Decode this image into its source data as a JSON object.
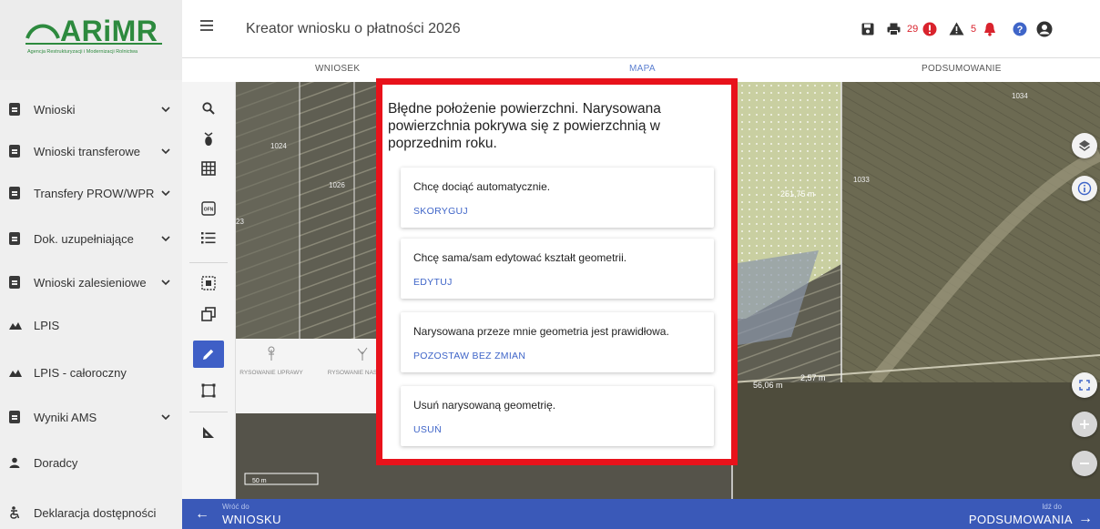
{
  "logo": {
    "name": "ARiMR",
    "subtitle": "Agencja Restrukturyzacji i Modernizacji Rolnictwa"
  },
  "sidebar": {
    "items": [
      {
        "label": "Wnioski",
        "icon": "clipboard-icon",
        "chevron": true
      },
      {
        "label": "Wnioski transferowe",
        "icon": "clipboard-icon",
        "chevron": true
      },
      {
        "label": "Transfery PROW/WPR",
        "icon": "clipboard-icon",
        "chevron": true
      },
      {
        "label": "Dok. uzupełniające",
        "icon": "clipboard-icon",
        "chevron": true
      },
      {
        "label": "Wnioski zalesieniowe",
        "icon": "clipboard-icon",
        "chevron": true
      },
      {
        "label": "LPIS",
        "icon": "mountain-icon",
        "chevron": false
      },
      {
        "label": "LPIS - całoroczny",
        "icon": "mountain-icon",
        "chevron": false
      },
      {
        "label": "Wyniki AMS",
        "icon": "clipboard-icon",
        "chevron": true
      },
      {
        "label": "Doradcy",
        "icon": "person-icon",
        "chevron": false
      },
      {
        "label": "Deklaracja dostępności",
        "icon": "accessibility-icon",
        "chevron": false
      }
    ]
  },
  "header": {
    "title": "Kreator wniosku o płatności 2026",
    "errors_count": "29",
    "warnings_count": "5"
  },
  "tabs": [
    {
      "label": "WNIOSEK"
    },
    {
      "label": "MAPA"
    },
    {
      "label": "PODSUMOWANIE"
    }
  ],
  "map": {
    "parcels": [
      "1024",
      "1026",
      "1033",
      "1034",
      "23"
    ],
    "measures": [
      "251,75 m",
      "56,06 m",
      "2,57 m"
    ],
    "scale": "50 m"
  },
  "draw_panel": {
    "options": [
      "RYSOWANIE UPRAWY",
      "RYSOWANIE NASADZEŃ"
    ]
  },
  "dialog": {
    "title": "Błędne położenie powierzchni. Narysowana powierzchnia pokrywa się z powierzchnią w poprzednim roku.",
    "options": [
      {
        "text": "Chcę dociąć automatycznie.",
        "action": "SKORYGUJ"
      },
      {
        "text": "Chcę sama/sam edytować kształt geometrii.",
        "action": "EDYTUJ"
      },
      {
        "text": "Narysowana przeze mnie geometria jest prawidłowa.",
        "action": "POZOSTAW BEZ ZMIAN"
      },
      {
        "text": "Usuń narysowaną geometrię.",
        "action": "USUŃ"
      }
    ]
  },
  "bottom": {
    "back_small": "Wróć do",
    "back_big": "WNIOSKU",
    "forward_small": "Idź do",
    "forward_big": "PODSUMOWANIA"
  },
  "colors": {
    "brand_green": "#2d8a3e",
    "accent_blue": "#3a59b8",
    "dialog_highlight": "#e8121b",
    "error_red": "#d9232d"
  }
}
